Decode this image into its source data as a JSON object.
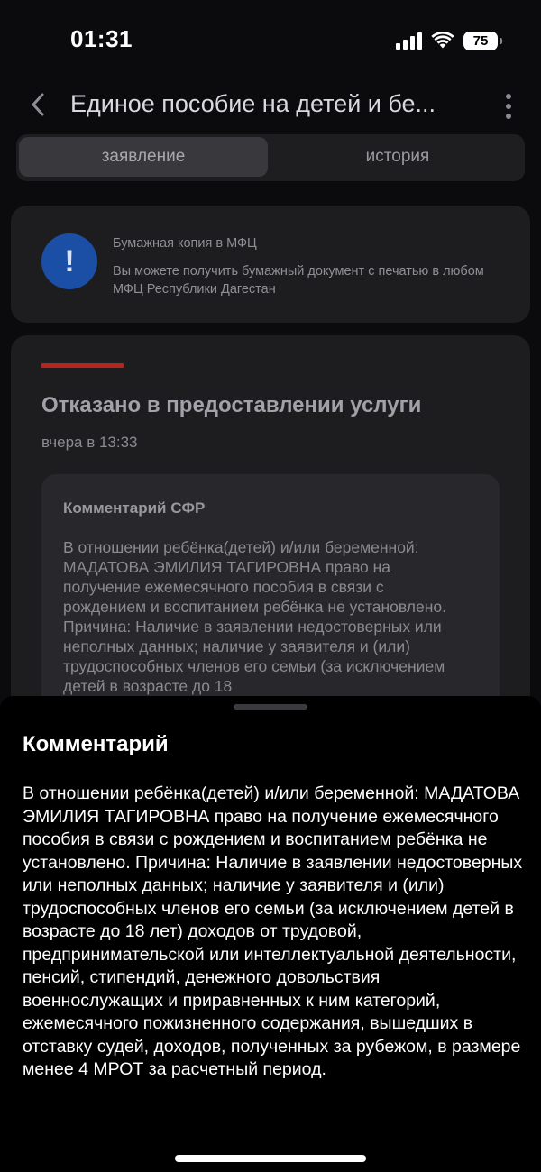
{
  "status_bar": {
    "time": "01:31",
    "battery": "75"
  },
  "header": {
    "title": "Единое пособие на детей и бе..."
  },
  "tabs": [
    {
      "label": "заявление",
      "active": true
    },
    {
      "label": "история",
      "active": false
    }
  ],
  "info_card": {
    "icon": "exclamation-icon",
    "icon_color": "#1b4fa6",
    "title": "Бумажная копия в МФЦ",
    "text": "Вы можете получить бумажный документ с печатью в любом МФЦ Республики Дагестан"
  },
  "status_card": {
    "accent_color": "#b3261e",
    "title": "Отказано в предоставлении услуги",
    "time": "вчера в 13:33",
    "comment_title": "Комментарий СФР",
    "comment_text": "В отношении ребёнка(детей) и/или беременной: МАДАТОВА ЭМИЛИЯ ТАГИРОВНА право на получение ежемесячного пособия в связи с рождением и воспитанием ребёнка не установлено. Причина: Наличие в заявлении недостоверных или неполных данных; наличие у заявителя и (или) трудоспособных членов его семьи (за исключением детей в возрасте до 18"
  },
  "bottom_sheet": {
    "title": "Комментарий",
    "text": "В отношении ребёнка(детей) и/или беременной: МАДАТОВА ЭМИЛИЯ ТАГИРОВНА право на получение ежемесячного пособия в связи с рождением и воспитанием ребёнка не установлено. Причина: Наличие в заявлении недостоверных или неполных данных; наличие у заявителя и (или) трудоспособных членов его семьи (за исключением детей в возрасте до 18 лет) доходов от трудовой, предпринимательской или интеллектуальной деятельности, пенсий, стипендий, денежного довольствия военнослужащих и приравненных к ним категорий, ежемесячного пожизненного содержания, вышедших в отставку судей, доходов, полученных за рубежом, в размере менее 4 МРОТ за расчетный период."
  }
}
